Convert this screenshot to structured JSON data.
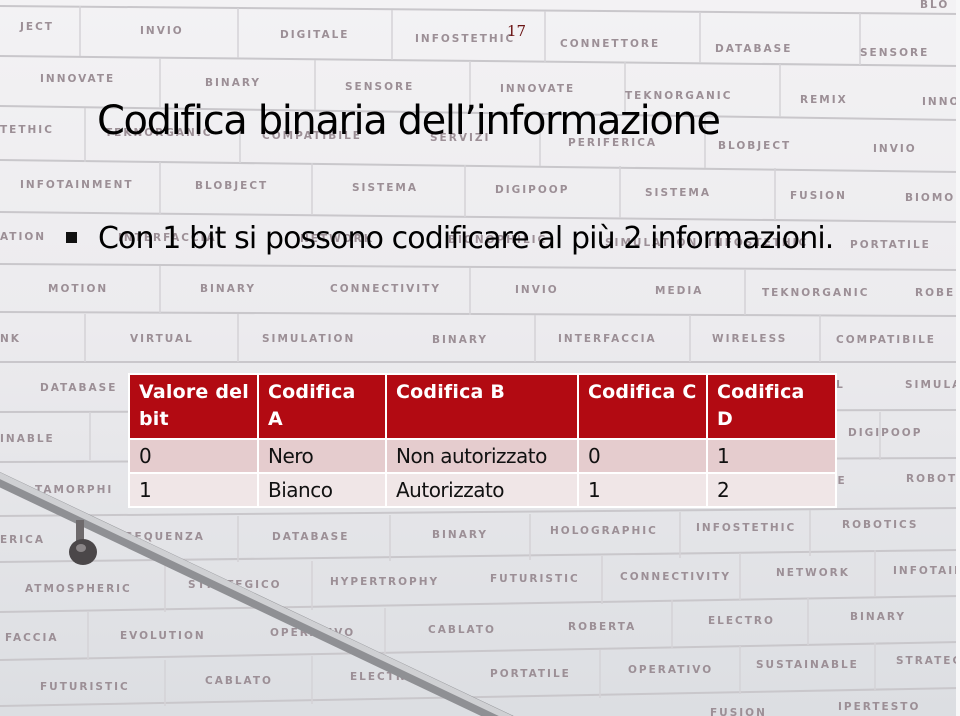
{
  "slide": {
    "page_number": "17",
    "title": "Codifica binaria dell’informazione",
    "bullets": [
      {
        "icon": "square-bullet-icon",
        "text": "Con 1 bit si possono codificare al più 2 informazioni."
      }
    ]
  },
  "table": {
    "header_color": "#b20a12",
    "row_colors": [
      "#e5ccce",
      "#f0e6e7"
    ],
    "columns": [
      "Valore del bit",
      "Codifica A",
      "Codifica B",
      "Codifica C",
      "Codifica D"
    ],
    "rows": [
      [
        "0",
        "Nero",
        "Non autorizzato",
        "0",
        "1"
      ],
      [
        "1",
        "Bianco",
        "Autorizzato",
        "1",
        "2"
      ]
    ]
  },
  "background": {
    "description": "photo of white tiled wall with engraved words and a metal handrail",
    "wall_words": [
      "JECT",
      "INVIO",
      "DIGITALE",
      "INFOSTETHIC",
      "CONNETTORE",
      "DATABASE",
      "SENSORE",
      "BLO",
      "INNOVATE",
      "BINARY",
      "SENSORE",
      "INNOVATE",
      "TEKNORGANIC",
      "REMIX",
      "INNO",
      "TETHIC",
      "TEKNORGANIC",
      "COMPATIBILE",
      "SERVIZI",
      "PERIFERICA",
      "BLOBJECT",
      "INVIO",
      "INFOTAINMENT",
      "BLOBJECT",
      "SISTEMA",
      "DIGIPOOP",
      "SISTEMA",
      "FUSION",
      "BIOMO",
      "ATION",
      "INTERFACCIA",
      "NETWORK",
      "BIONOPHILIC",
      "SIMULATION",
      "INFOSTETHIC",
      "PORTATILE",
      "MOTION",
      "BINARY",
      "CONNECTIVITY",
      "INVIO",
      "MEDIA",
      "TEKNORGANIC",
      "ROBER",
      "NK",
      "VIRTUAL",
      "SIMULATION",
      "BINARY",
      "INTERFACCIA",
      "WIRELESS",
      "COMPATIBILE",
      "DATABASE",
      "AL",
      "SIMULA",
      "INABLE",
      "DIGIPOOP",
      "TAMORPHI",
      "SE",
      "ROBOT",
      "ERICA",
      "SEQUENZA",
      "DATABASE",
      "BINARY",
      "HOLOGRAPHIC",
      "INFOSTETHIC",
      "ROBOTICS",
      "ATMOSPHERIC",
      "STRATEGICO",
      "HYPERTROPHY",
      "FUTURISTIC",
      "CONNECTIVITY",
      "NETWORK",
      "INFOTAIN",
      "FACCIA",
      "EVOLUTION",
      "OPERATIVO",
      "CABLATO",
      "ROBERTA",
      "ELECTRO",
      "BINARY",
      "FUTURISTIC",
      "CABLATO",
      "ELECTRO",
      "PORTATILE",
      "OPERATIVO",
      "SUSTAINABLE",
      "STRATEG",
      "FUSION",
      "IPERTESTO"
    ]
  }
}
